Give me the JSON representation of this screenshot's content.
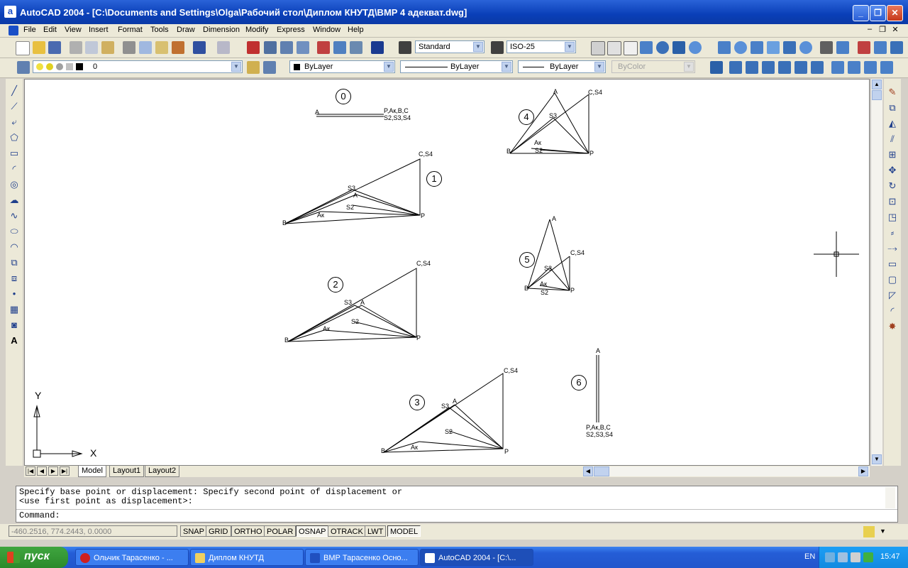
{
  "window": {
    "app_icon": "a",
    "title": "AutoCAD 2004 - [C:\\Documents and Settings\\Olga\\Рабочий стол\\Диплом КНУТД\\ВМР 4 адекват.dwg]",
    "minimize": "_",
    "restore": "❐",
    "close": "✕"
  },
  "menu": {
    "items": [
      "File",
      "Edit",
      "View",
      "Insert",
      "Format",
      "Tools",
      "Draw",
      "Dimension",
      "Modify",
      "Express",
      "Window",
      "Help"
    ],
    "doc_min": "–",
    "doc_restore": "❐",
    "doc_close": "✕"
  },
  "toolbar": {
    "text_style": "Standard",
    "dim_style": "ISO-25",
    "layer": "0",
    "color": "ByLayer",
    "linetype": "ByLayer",
    "lineweight": "ByLayer",
    "plotstyle": "ByColor"
  },
  "drawing": {
    "ucs_x": "X",
    "ucs_y": "Y",
    "fig0": {
      "num": "0",
      "a": "A",
      "right1": "P,Aк,B,C",
      "right2": "S2,S3,S4"
    },
    "fig1": {
      "num": "1",
      "c": "C,S4",
      "s3": "S3",
      "a": "A",
      "s2": "S2",
      "ak": "Aк",
      "b": "B",
      "p": "P"
    },
    "fig2": {
      "num": "2",
      "c": "C,S4",
      "s3": "S3",
      "a": "A",
      "s2": "S2",
      "ak": "Aк",
      "b": "B",
      "p": "P"
    },
    "fig3": {
      "num": "3",
      "c": "C,S4",
      "s3": "S3",
      "a": "A",
      "s2": "S2",
      "ak": "Aк",
      "b": "B",
      "p": "P"
    },
    "fig4": {
      "num": "4",
      "a": "A",
      "c": "C,S4",
      "s3": "S3",
      "ak": "Aк",
      "b": "B",
      "s2": "S2",
      "p": "P"
    },
    "fig5": {
      "num": "5",
      "a": "A",
      "c": "C,S4",
      "s3": "S3",
      "ak": "Aк",
      "b": "B",
      "s2": "S2",
      "p": "P"
    },
    "fig6": {
      "num": "6",
      "a": "A",
      "bottom1": "P,Aк,B,C",
      "bottom2": "S2,S3,S4"
    }
  },
  "tabs": [
    "Model",
    "Layout1",
    "Layout2"
  ],
  "command": {
    "line1": "Specify base point or displacement: Specify second point of displacement or",
    "line2": "<use first point as displacement>:",
    "prompt": "Command:"
  },
  "status": {
    "coords": "-460.2516, 774.2443, 0.0000",
    "buttons": [
      "SNAP",
      "GRID",
      "ORTHO",
      "POLAR",
      "OSNAP",
      "OTRACK",
      "LWT",
      "MODEL"
    ],
    "active": [
      "OSNAP",
      "MODEL"
    ]
  },
  "taskbar": {
    "start": "пуск",
    "tasks": [
      "Ольчик Тарасенко - ...",
      "Диплом КНУТД",
      "ВМР Тарасенко Осно...",
      "AutoCAD 2004 - [C:\\..."
    ],
    "lang": "EN",
    "time": "15:47"
  }
}
